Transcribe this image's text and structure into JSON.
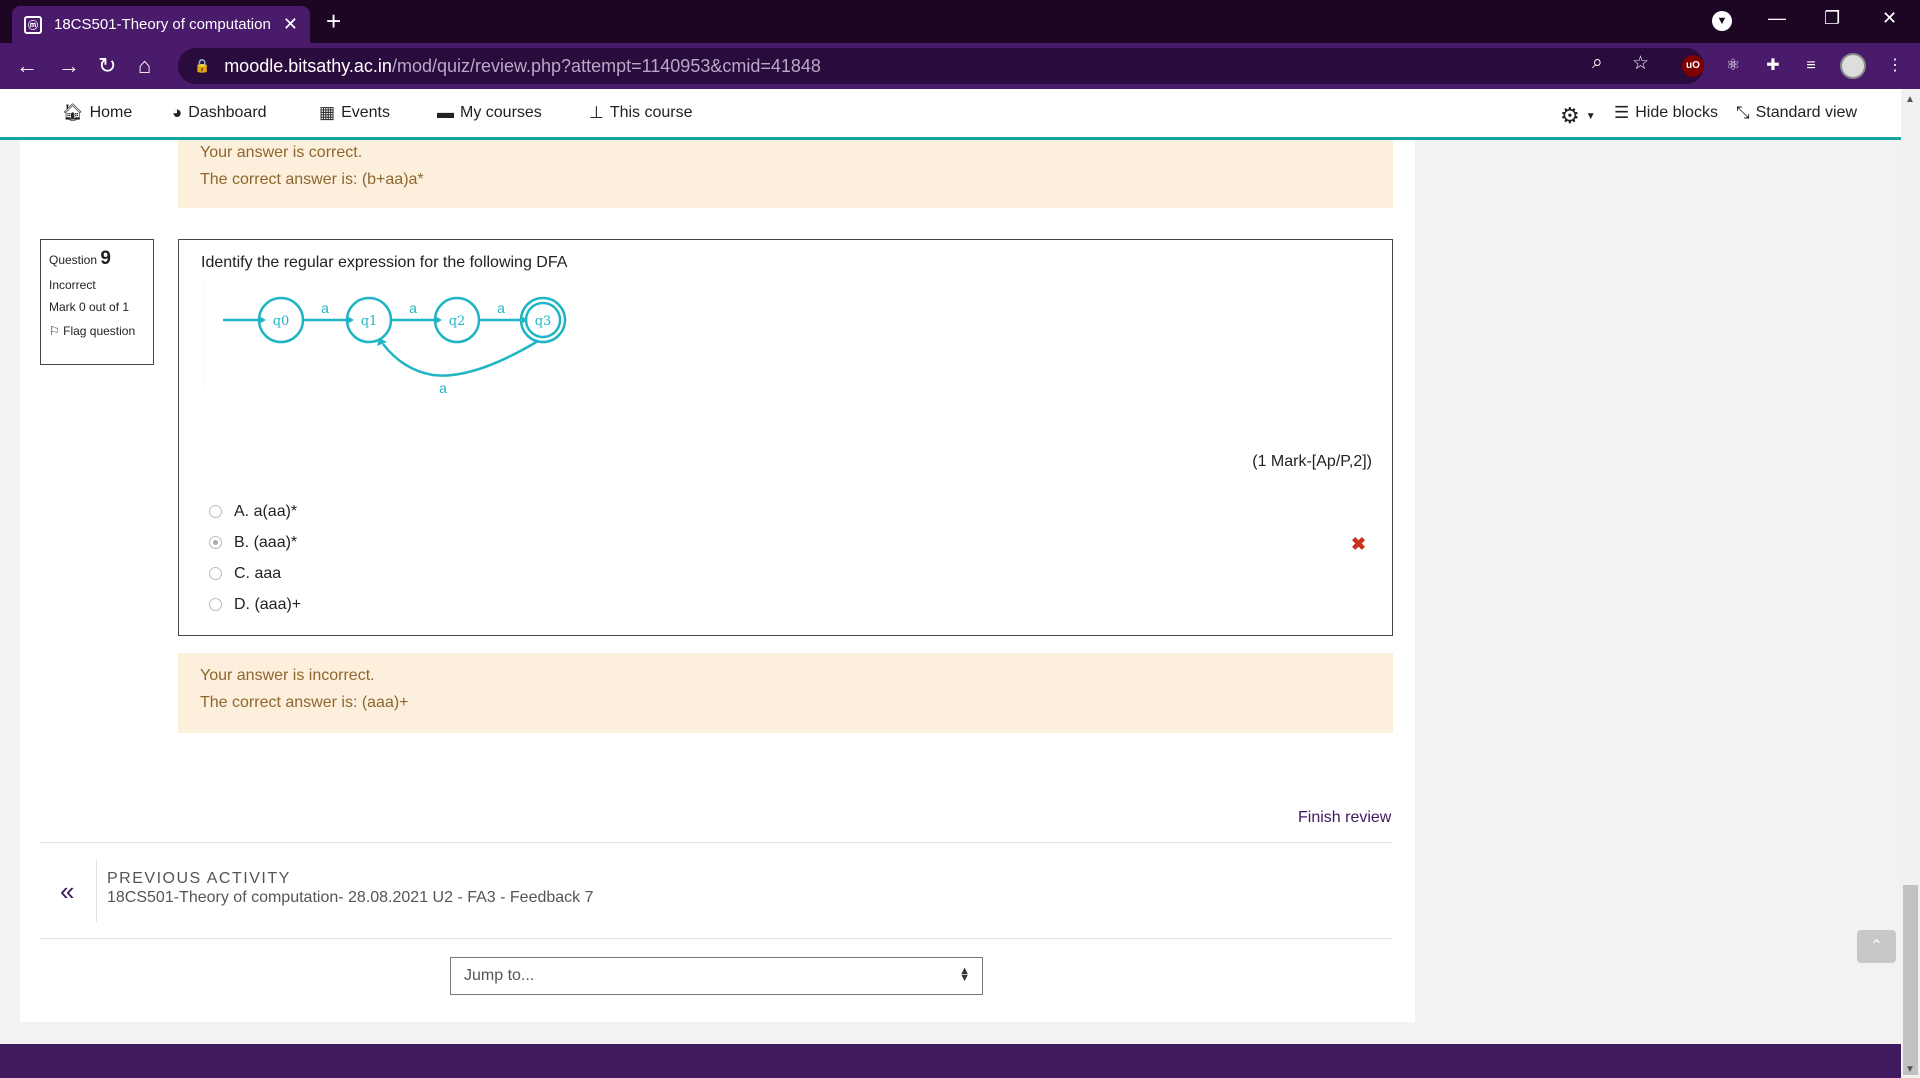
{
  "browser": {
    "tab_title": "18CS501-Theory of computation",
    "url_host": "moodle.bitsathy.ac.in",
    "url_path": "/mod/quiz/review.php?attempt=1140953&cmid=41848"
  },
  "nav": {
    "home": "Home",
    "dashboard": "Dashboard",
    "events": "Events",
    "my_courses": "My courses",
    "this_course": "This course",
    "hide_blocks": "Hide blocks",
    "standard_view": "Standard view"
  },
  "prev_feedback": {
    "line1": "Your answer is correct.",
    "line2": "The correct answer is: (b+aa)a*"
  },
  "question": {
    "label": "Question",
    "number": "9",
    "status": "Incorrect",
    "mark": "Mark 0 out of 1",
    "flag": "Flag question",
    "text": "Identify the regular expression for the following DFA",
    "marks_info": "(1 Mark-[Ap/P,2])",
    "options": [
      {
        "label": "A. a(aa)*",
        "selected": false
      },
      {
        "label": "B. (aaa)*",
        "selected": true
      },
      {
        "label": "C. aaa",
        "selected": false
      },
      {
        "label": "D. (aaa)+",
        "selected": false
      }
    ],
    "dfa": {
      "states": [
        "q0",
        "q1",
        "q2",
        "q3"
      ],
      "transition_label": "a"
    }
  },
  "feedback": {
    "line1": "Your answer is incorrect.",
    "line2": "The correct answer is: (aaa)+"
  },
  "footer": {
    "finish_review": "Finish review",
    "prev_activity_label": "PREVIOUS ACTIVITY",
    "prev_activity_title": "18CS501-Theory of computation- 28.08.2021 U2 - FA3 - Feedback 7",
    "jump_placeholder": "Jump to..."
  },
  "colors": {
    "brand": "#4a1a6b",
    "accent": "#17a3a0",
    "dfa": "#1fb5c4",
    "incorrect": "#ca3120"
  }
}
